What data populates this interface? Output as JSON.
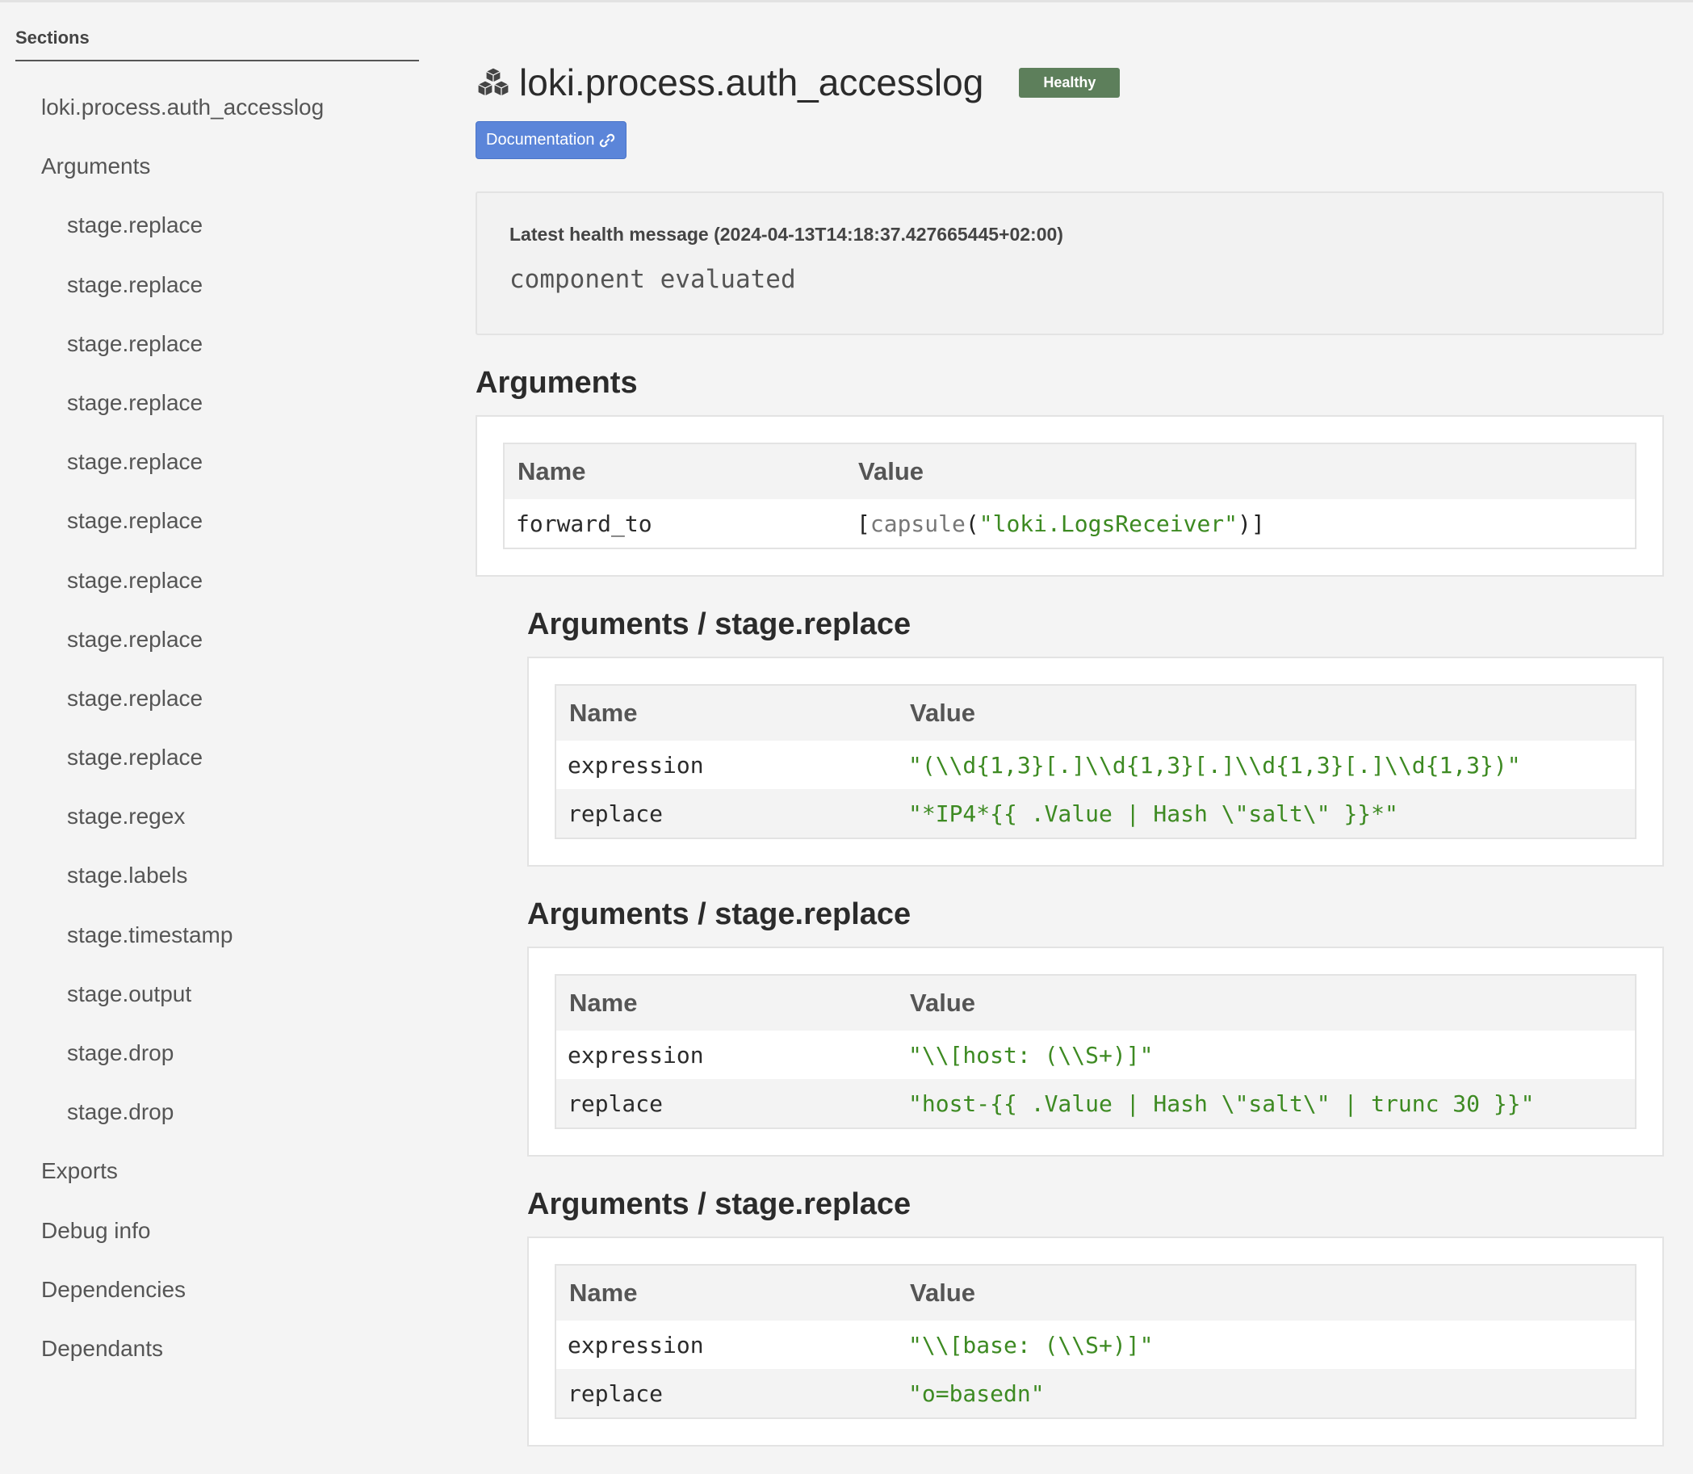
{
  "sidebar": {
    "heading": "Sections",
    "items": [
      {
        "label": "loki.process.auth_accesslog",
        "level": 1
      },
      {
        "label": "Arguments",
        "level": 1
      },
      {
        "label": "stage.replace",
        "level": 2
      },
      {
        "label": "stage.replace",
        "level": 2
      },
      {
        "label": "stage.replace",
        "level": 2
      },
      {
        "label": "stage.replace",
        "level": 2
      },
      {
        "label": "stage.replace",
        "level": 2
      },
      {
        "label": "stage.replace",
        "level": 2
      },
      {
        "label": "stage.replace",
        "level": 2
      },
      {
        "label": "stage.replace",
        "level": 2
      },
      {
        "label": "stage.replace",
        "level": 2
      },
      {
        "label": "stage.replace",
        "level": 2
      },
      {
        "label": "stage.regex",
        "level": 2
      },
      {
        "label": "stage.labels",
        "level": 2
      },
      {
        "label": "stage.timestamp",
        "level": 2
      },
      {
        "label": "stage.output",
        "level": 2
      },
      {
        "label": "stage.drop",
        "level": 2
      },
      {
        "label": "stage.drop",
        "level": 2
      },
      {
        "label": "Exports",
        "level": 1
      },
      {
        "label": "Debug info",
        "level": 1
      },
      {
        "label": "Dependencies",
        "level": 1
      },
      {
        "label": "Dependants",
        "level": 1
      }
    ]
  },
  "header": {
    "title": "loki.process.auth_accesslog",
    "status": "Healthy",
    "documentation_label": "Documentation",
    "icon": "cubes-icon"
  },
  "health": {
    "label": "Latest health message (2024-04-13T14:18:37.427665445+02:00)",
    "message": "component evaluated"
  },
  "arguments": {
    "heading": "Arguments",
    "columns": [
      "Name",
      "Value"
    ],
    "rows": [
      {
        "name": "forward_to",
        "value_open": "[",
        "value_fn": "capsule",
        "value_paren_open": "(",
        "value_str": "\"loki.LogsReceiver\"",
        "value_close": ")]"
      }
    ]
  },
  "subsections": [
    {
      "heading": "Arguments / stage.replace",
      "columns": [
        "Name",
        "Value"
      ],
      "rows": [
        {
          "name": "expression",
          "value": "\"(\\\\d{1,3}[.]\\\\d{1,3}[.]\\\\d{1,3}[.]\\\\d{1,3})\""
        },
        {
          "name": "replace",
          "value": "\"*IP4*{{ .Value | Hash \\\"salt\\\" }}*\""
        }
      ]
    },
    {
      "heading": "Arguments / stage.replace",
      "columns": [
        "Name",
        "Value"
      ],
      "rows": [
        {
          "name": "expression",
          "value": "\"\\\\[host: (\\\\S+)]\""
        },
        {
          "name": "replace",
          "value": "\"host-{{ .Value | Hash \\\"salt\\\" | trunc 30 }}\""
        }
      ]
    },
    {
      "heading": "Arguments / stage.replace",
      "columns": [
        "Name",
        "Value"
      ],
      "rows": [
        {
          "name": "expression",
          "value": "\"\\\\[base: (\\\\S+)]\""
        },
        {
          "name": "replace",
          "value": "\"o=basedn\""
        }
      ]
    }
  ],
  "colors": {
    "badge": "#5d7f5b",
    "doc_button": "#5b85d9",
    "string_value": "#3d8a22"
  }
}
